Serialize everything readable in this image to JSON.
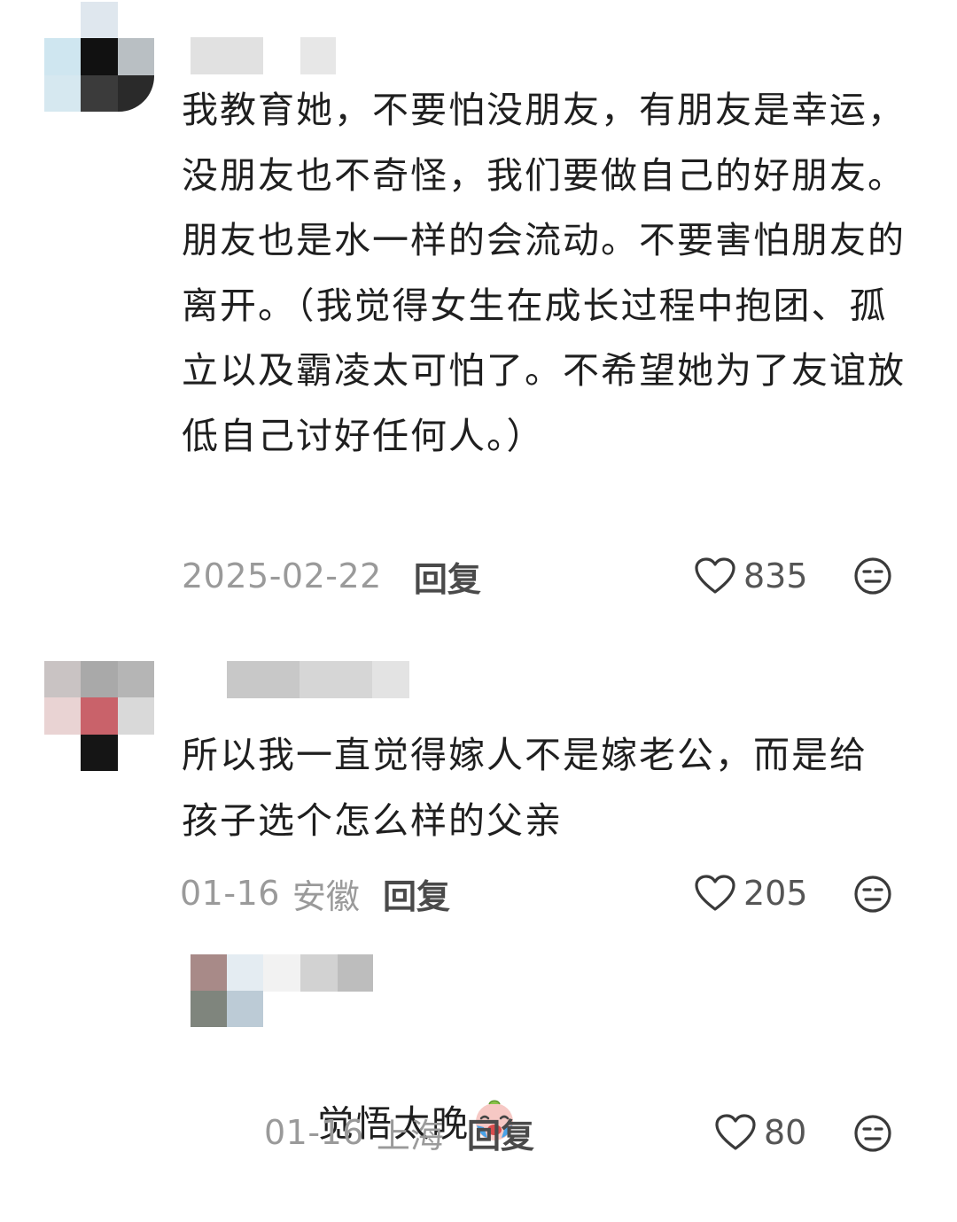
{
  "comments": [
    {
      "text": "我教育她，不要怕没朋友，有朋友是幸运，没朋友也不奇怪，我们要做自己的好朋友。朋友也是水一样的会流动。不要害怕朋友的离开。（我觉得女生在成长过程中抱团、孤立以及霸凌太可怕了。不希望她为了友谊放低自己讨好任何人。）",
      "date": "2025-02-22",
      "location": "",
      "reply_label": "回复",
      "likes": "835"
    },
    {
      "text": "所以我一直觉得嫁人不是嫁老公，而是给孩子选个怎么样的父亲",
      "date": "01-16",
      "location": "安徽",
      "reply_label": "回复",
      "likes": "205"
    },
    {
      "text": "觉悟太晚",
      "date": "01-16",
      "location": "上海",
      "reply_label": "回复",
      "likes": "80"
    }
  ],
  "icons": {
    "like": "heart-outline-icon",
    "dislike": "neutral-face-icon",
    "inline_emoji": "crying-face-emoji"
  },
  "colors": {
    "text": "#1f1f1f",
    "meta": "#9a9a9a",
    "reply": "#4a4a4a"
  }
}
